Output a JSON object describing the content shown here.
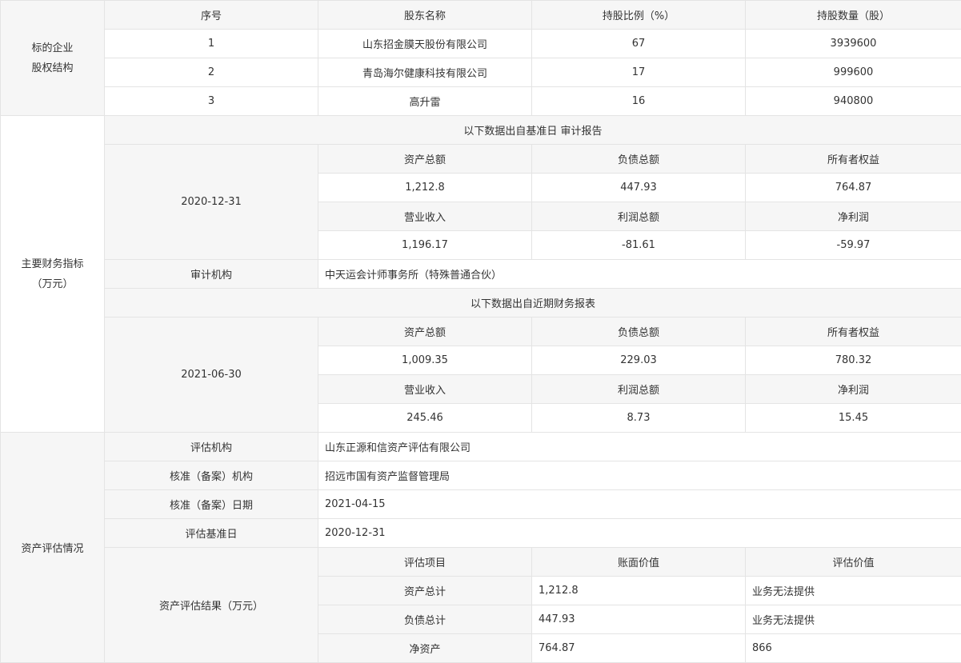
{
  "equity": {
    "section_label_line1": "标的企业",
    "section_label_line2": "股权结构",
    "headers": [
      "序号",
      "股东名称",
      "持股比例（%）",
      "持股数量（股）"
    ],
    "rows": [
      {
        "no": "1",
        "name": "山东招金膜天股份有限公司",
        "ratio": "67",
        "shares": "3939600"
      },
      {
        "no": "2",
        "name": "青岛海尔健康科技有限公司",
        "ratio": "17",
        "shares": "999600"
      },
      {
        "no": "3",
        "name": "高升雷",
        "ratio": "16",
        "shares": "940800"
      }
    ]
  },
  "financials": {
    "section_label_line1": "主要财务指标",
    "section_label_line2": "（万元）",
    "audit_banner": "以下数据出自基准日 审计报告",
    "audit_date": "2020-12-31",
    "metric_headers_1": [
      "资产总额",
      "负债总额",
      "所有者权益"
    ],
    "metric_headers_2": [
      "营业收入",
      "利润总额",
      "净利润"
    ],
    "audit_values_1": [
      "1,212.8",
      "447.93",
      "764.87"
    ],
    "audit_values_2": [
      "1,196.17",
      "-81.61",
      "-59.97"
    ],
    "auditor_label": "审计机构",
    "auditor_value": "中天运会计师事务所（特殊普通合伙）",
    "recent_banner": "以下数据出自近期财务报表",
    "recent_date": "2021-06-30",
    "recent_values_1": [
      "1,009.35",
      "229.03",
      "780.32"
    ],
    "recent_values_2": [
      "245.46",
      "8.73",
      "15.45"
    ]
  },
  "valuation": {
    "section_label": "资产评估情况",
    "rows": [
      {
        "label": "评估机构",
        "value": "山东正源和信资产评估有限公司"
      },
      {
        "label": "核准（备案）机构",
        "value": "招远市国有资产监督管理局"
      },
      {
        "label": "核准（备案）日期",
        "value": "2021-04-15"
      },
      {
        "label": "评估基准日",
        "value": "2020-12-31"
      }
    ],
    "result_label": "资产评估结果（万元）",
    "result_headers": [
      "评估项目",
      "账面价值",
      "评估价值"
    ],
    "results": [
      {
        "item": "资产总计",
        "book": "1,212.8",
        "appraised": "业务无法提供"
      },
      {
        "item": "负债总计",
        "book": "447.93",
        "appraised": "业务无法提供"
      },
      {
        "item": "净资产",
        "book": "764.87",
        "appraised": "866"
      }
    ]
  }
}
